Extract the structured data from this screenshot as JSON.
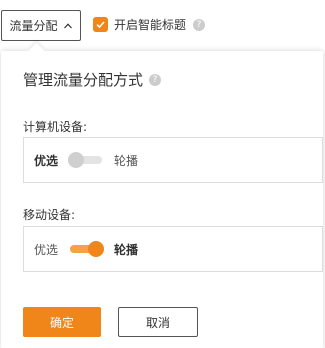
{
  "toolbar": {
    "dropdown_label": "流量分配",
    "dropdown_icon": "chevron-up-icon",
    "smart_title_checked": true,
    "smart_title_label": "开启智能标题",
    "help_icon": "question-icon"
  },
  "panel": {
    "title": "管理流量分配方式",
    "computer": {
      "label": "计算机设备:",
      "option_left": "优选",
      "option_right": "轮播",
      "selected": "优选",
      "toggle_on": false
    },
    "mobile": {
      "label": "移动设备:",
      "option_left": "优选",
      "option_right": "轮播",
      "selected": "轮播",
      "toggle_on": true
    },
    "confirm_label": "确定",
    "cancel_label": "取消"
  },
  "colors": {
    "accent": "#f08519",
    "border": "#dddddd",
    "text": "#333333",
    "toggle_off": "#cfcfcf"
  }
}
